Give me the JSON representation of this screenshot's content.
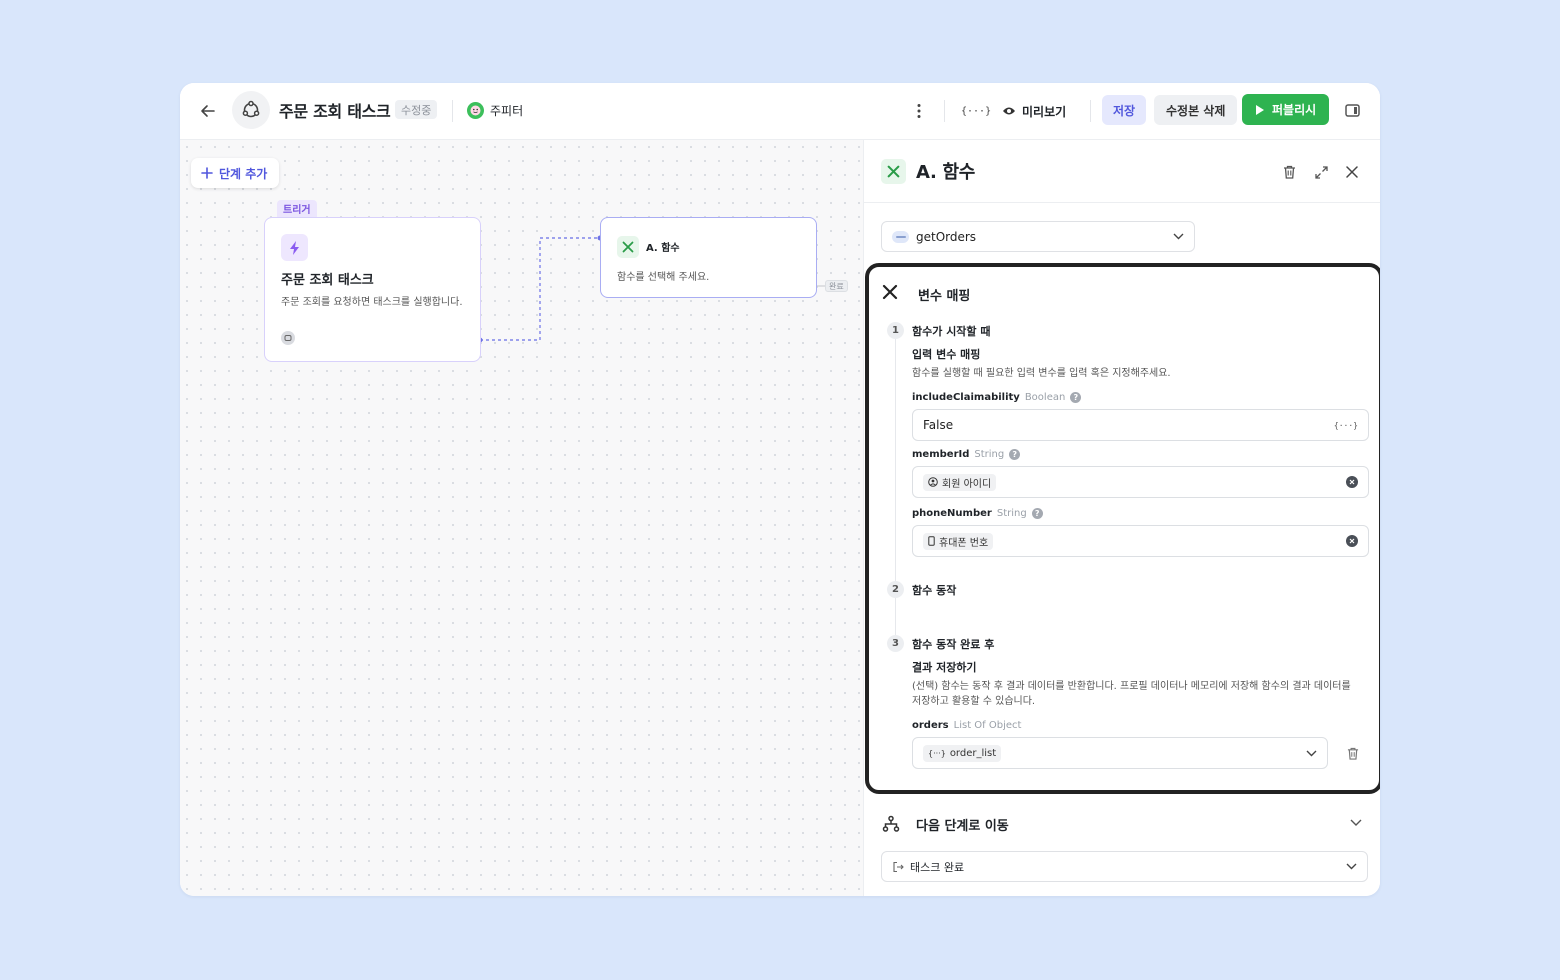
{
  "header": {
    "title": "주문 조회 태스크",
    "status_badge": "수정중",
    "user_name": "주피터",
    "variables_label": "{···}",
    "preview_label": "미리보기",
    "save_label": "저장",
    "delete_revision_label": "수정본 삭제",
    "publish_label": "퍼블리시"
  },
  "canvas": {
    "add_step_label": "단계 추가",
    "trigger_tag": "트리거",
    "trigger_title": "주문 조회 태스크",
    "trigger_description": "주문 조회를 요청하면 태스크를 실행합니다.",
    "function_node_title": "A. 함수",
    "function_node_description": "함수를 선택해 주세요.",
    "done_tag": "완료"
  },
  "panel": {
    "title": "A. 함수",
    "function_select": "getOrders",
    "mapping": {
      "title": "변수 매핑",
      "step1": {
        "number": "1",
        "title": "함수가 시작할 때",
        "subtitle": "입력 변수 매핑",
        "description": "함수를 실행할 때 필요한 입력 변수를 입력 혹은 지정해주세요.",
        "fields": [
          {
            "name": "includeClaimability",
            "type": "Boolean",
            "value": "False",
            "action": "{···}"
          },
          {
            "name": "memberId",
            "type": "String",
            "value": "회원 아이디"
          },
          {
            "name": "phoneNumber",
            "type": "String",
            "value": "휴대폰 번호"
          }
        ]
      },
      "step2": {
        "number": "2",
        "title": "함수 동작"
      },
      "step3": {
        "number": "3",
        "title": "함수 동작 완료 후",
        "subtitle": "결과 저장하기",
        "description": "(선택) 함수는 동작 후 결과 데이터를 반환합니다. 프로필 데이터나 메모리에 저장해 함수의 결과 데이터를 저장하고 활용할 수 있습니다.",
        "output": {
          "name": "orders",
          "type": "List Of Object",
          "value": "order_list",
          "prefix": "{···}"
        }
      }
    },
    "next": {
      "title": "다음 단계로 이동",
      "value": "태스크 완료"
    }
  },
  "colors": {
    "accent": "#5157dd",
    "publish": "#2eb350",
    "trigger": "#7b55e0",
    "background": "#d9e6fb"
  }
}
